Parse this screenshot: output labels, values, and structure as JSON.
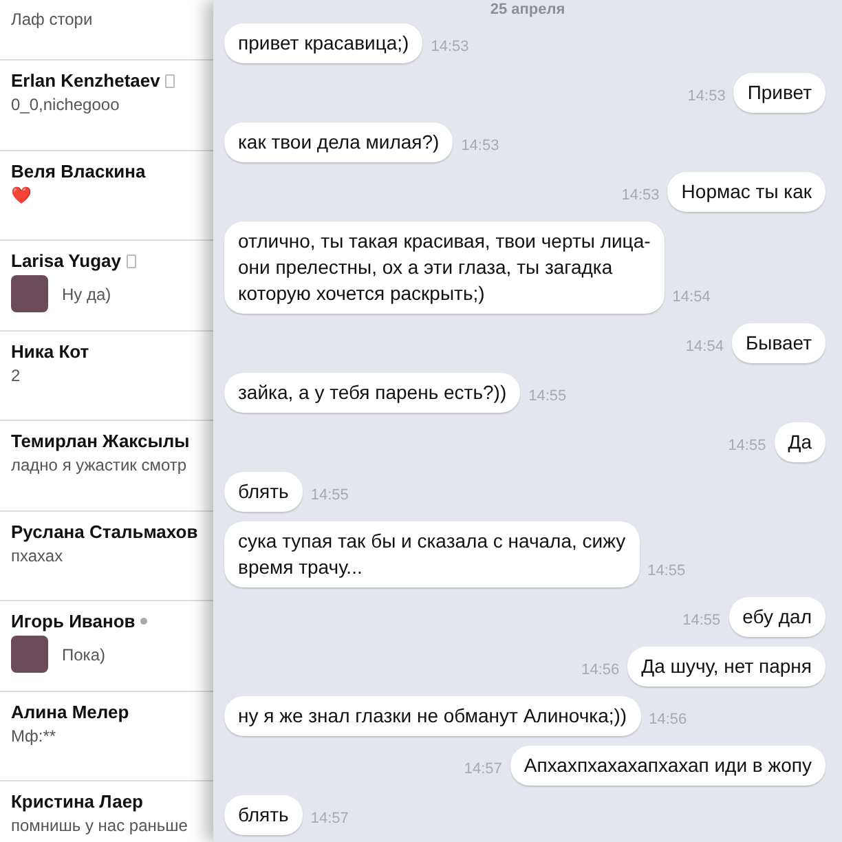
{
  "contacts": [
    {
      "preview": "Лаф стори",
      "mobile": false,
      "online": false,
      "avatar": false
    },
    {
      "name": "Erlan Kenzhetaev",
      "preview": "0_0,nichegooo",
      "mobile": true,
      "online": false,
      "avatar": false
    },
    {
      "name": "Веля Власкина",
      "preview": "❤️",
      "mobile": false,
      "online": false,
      "avatar": false
    },
    {
      "name": "Larisa Yugay",
      "preview": "Ну да)",
      "mobile": true,
      "online": false,
      "avatar": true
    },
    {
      "name": "Ника Кот",
      "preview": "2",
      "mobile": false,
      "online": false,
      "avatar": false
    },
    {
      "name": "Темирлан Жаксылы",
      "preview": "ладно я ужастик смотр",
      "mobile": false,
      "online": false,
      "avatar": false
    },
    {
      "name": "Руслана Стальмахов",
      "preview": "пхахах",
      "mobile": false,
      "online": false,
      "avatar": false
    },
    {
      "name": "Игорь Иванов",
      "preview": "Пока)",
      "mobile": false,
      "online": true,
      "avatar": true
    },
    {
      "name": "Алина Мелер",
      "preview": "Мф:**",
      "mobile": false,
      "online": false,
      "avatar": false
    },
    {
      "name": "Кристина Лаер",
      "preview": "помнишь у нас раньше",
      "mobile": false,
      "online": false,
      "avatar": false
    }
  ],
  "chat": {
    "date": "25 апреля",
    "messages": [
      {
        "outgoing": false,
        "text": "привет красавица;)",
        "time": "14:53"
      },
      {
        "outgoing": true,
        "text": "Привет",
        "time": "14:53"
      },
      {
        "outgoing": false,
        "text": "как твои дела милая?)",
        "time": "14:53"
      },
      {
        "outgoing": true,
        "text": "Нормас ты как",
        "time": "14:53"
      },
      {
        "outgoing": false,
        "text": "отлично, ты такая красивая, твои черты лица-\nони прелестны, ох а эти глаза, ты загадка\nкоторую хочется раскрыть;)",
        "time": "14:54"
      },
      {
        "outgoing": true,
        "text": "Бывает",
        "time": "14:54"
      },
      {
        "outgoing": false,
        "text": "зайка, а у тебя парень есть?))",
        "time": "14:55"
      },
      {
        "outgoing": true,
        "text": "Да",
        "time": "14:55"
      },
      {
        "outgoing": false,
        "text": "блять",
        "time": "14:55"
      },
      {
        "outgoing": false,
        "text": "сука тупая так бы и сказала с начала, сижу\nвремя трачу...",
        "time": "14:55"
      },
      {
        "outgoing": true,
        "text": "ебу дал",
        "time": "14:55"
      },
      {
        "outgoing": true,
        "text": "Да шучу, нет парня",
        "time": "14:56"
      },
      {
        "outgoing": false,
        "text": "ну я же знал глазки не обманут Алиночка;))",
        "time": "14:56"
      },
      {
        "outgoing": true,
        "text": "Апхахпхахахапхахап иди в жопу",
        "time": "14:57"
      },
      {
        "outgoing": false,
        "text": "блять",
        "time": "14:57"
      }
    ]
  }
}
